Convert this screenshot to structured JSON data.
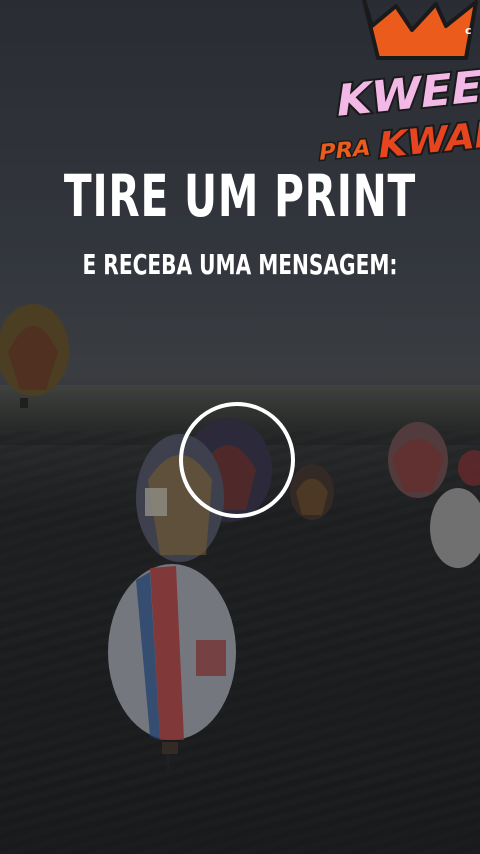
{
  "brand": {
    "logo_text_line1": "KWEEN",
    "logo_text_line2": "PRA",
    "logo_text_line3": "KWAI",
    "badge_letter": "c",
    "colors": {
      "crown": "#ea5b1c",
      "kween_fill": "#f2b8e6",
      "outline": "#1a1a1a",
      "kwai_fill": "#e6451f"
    }
  },
  "main": {
    "headline": "TIRE UM PRINT",
    "subheadline": "E RECEBA UMA MENSAGEM:"
  },
  "shutter": {
    "icon": "capture-circle-icon",
    "color": "#ffffff"
  }
}
